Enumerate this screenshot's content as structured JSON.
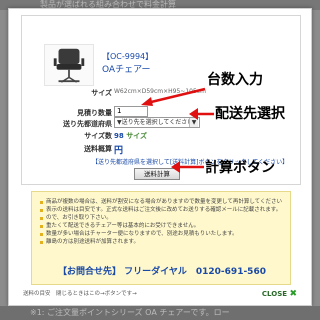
{
  "background": {
    "top_text": "製品が選ばれる組み合わせで料金計算",
    "bottom_text": "※1: ご注文量ポイントシリーズ OA チェアーです。ロー"
  },
  "product": {
    "code": "【OC-9994】",
    "name": "OAチェアー",
    "size_label": "サイズ",
    "size_value": "W62cm×D59cm×H95~105cm"
  },
  "form": {
    "qty_label": "見積り数量",
    "qty_value": "1",
    "dest_label": "送り先都道府県",
    "dest_value": "▼送り先を選択してください",
    "size_count_label": "サイズ数",
    "size_count_num": "98",
    "size_count_unit": "サイズ",
    "fee_label": "送料概算",
    "fee_value": "円",
    "note": "【送り先都道府県を選択して[送料計算]ボタンをクリックしてください】",
    "calc_button": "送料計算"
  },
  "annotations": {
    "qty": "台数入力",
    "dest": "配送先選択",
    "calc": "計算ボタン"
  },
  "info": {
    "lines": [
      "商品が複数の場合は、送料が割安になる場合がありますので数量を変更して再計算してください。",
      "表示の送料は目安です。正式な送料はご注文後に改めてお送りする確認メールに記載されます。",
      "ので、お引き取り下さい。",
      "重たくて配送できるチェアー等は基本的にお受けできません。",
      "数量が多い場合はチャーター便になりますので、別途お見積もりいたします。",
      "離島の方は別途送料が加算されます。"
    ],
    "contact": "【お問合せ先】 フリーダイヤル　0120-691-560"
  },
  "footer": {
    "left_text": "送料の目安　閉じるときはこの→ボタンです→",
    "close_label": "CLOSE",
    "close_icon": "✖"
  }
}
